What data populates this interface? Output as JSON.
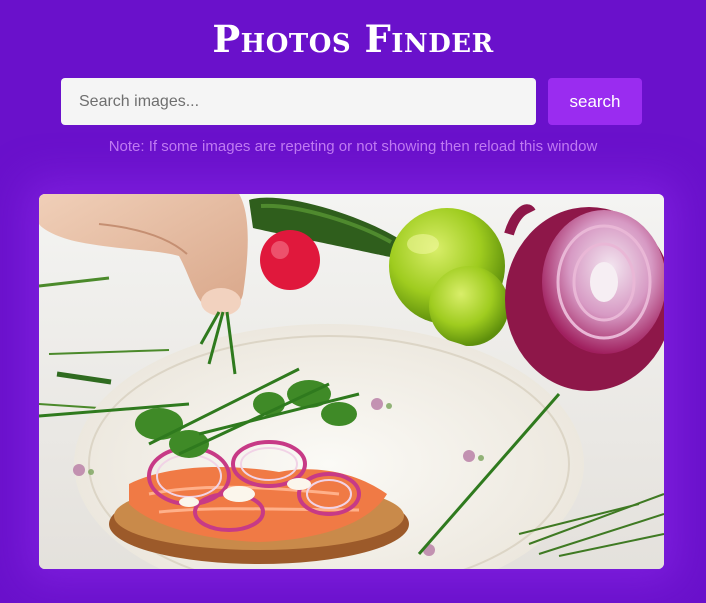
{
  "header": {
    "title": "Photos Finder"
  },
  "search": {
    "placeholder": "Search images...",
    "value": "",
    "button_label": "search"
  },
  "note": {
    "text": "Note: If some images are repeting or not showing then reload this window"
  },
  "colors": {
    "background": "#6a11cb",
    "button": "#9a2cf0",
    "note_text": "#c17cf2",
    "input_bg": "#f5f5f5"
  },
  "gallery": {
    "images": [
      {
        "subject": "hand sprinkling chives over salmon and red onion open sandwich on floral plate, limes and red onion in background"
      }
    ]
  }
}
